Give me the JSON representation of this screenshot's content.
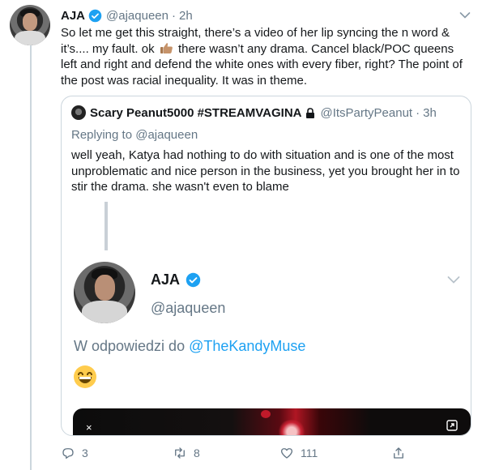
{
  "tweet": {
    "author_name": "AJA",
    "author_handle": "@ajaqueen",
    "separator": "·",
    "time": "2h",
    "text_before_emoji": "So let me get this straight, there’s a video of her lip syncing the n word & it’s.... my fault. ok",
    "text_after_emoji": "there wasn’t any drama. Cancel black/POC queens left and right and defend the white ones with every fiber, right? The point of the post was racial inequality. It was in theme.",
    "emoji": "thumbs-up-medium-skin-tone"
  },
  "quote": {
    "author_name": "Scary Peanut5000 #STREAMVAGINA",
    "author_handle": "@ItsPartyPeanut",
    "separator": "·",
    "time": "3h",
    "replying_prefix": "Replying to",
    "replying_to": "@ajaqueen",
    "text": "well yeah, Katya had nothing to do with situation and is one of the most unproblematic and nice person in the business, yet you brought her in to stir the drama. she wasn't even to blame",
    "screenshot": {
      "author_name": "AJA",
      "author_handle": "@ajaqueen",
      "reply_prefix": "W odpowiedzi do",
      "reply_mention": "@TheKandyMuse",
      "emoji": "grinning-face",
      "video_close": "×"
    }
  },
  "actions": {
    "replies": "3",
    "retweets": "8",
    "likes": "111"
  },
  "colors": {
    "primary_text": "#14171a",
    "secondary_text": "#657786",
    "link": "#1da1f2",
    "border": "#ccd6dd",
    "verified": "#1da1f2"
  }
}
